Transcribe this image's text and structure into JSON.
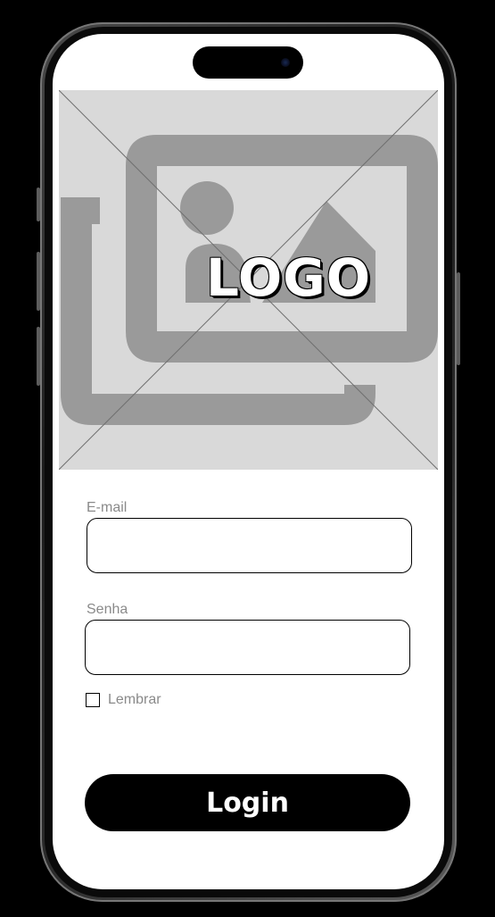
{
  "logo": {
    "text": "LOGO",
    "placeholder_icon": "image-placeholder-icon"
  },
  "form": {
    "email_label": "E-mail",
    "email_value": "",
    "password_label": "Senha",
    "password_value": "",
    "remember_label": "Lembrar",
    "remember_checked": false,
    "login_label": "Login"
  },
  "colors": {
    "background": "#000000",
    "screen": "#ffffff",
    "placeholder_bg": "#d9d9d9",
    "placeholder_icon": "#999999",
    "label_text": "#8a8a8a",
    "button_bg": "#000000",
    "button_text": "#ffffff"
  }
}
